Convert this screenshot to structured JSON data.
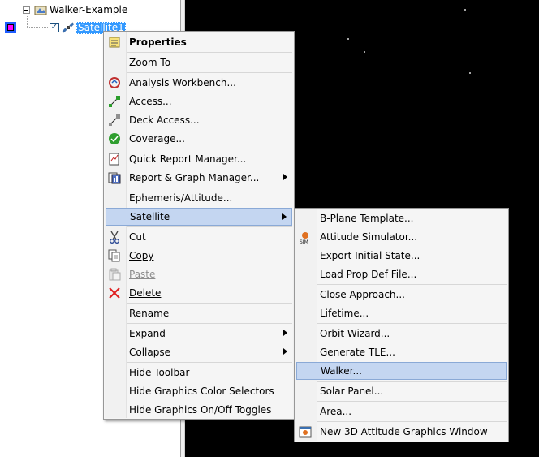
{
  "tree": {
    "root_label": "Walker-Example",
    "child_label": "Satellite1",
    "child_checked": true,
    "color_swatch": "#ff00ff"
  },
  "context_menu": {
    "items": [
      {
        "label": "Properties",
        "icon": "properties-icon",
        "bold": true
      },
      {
        "label": "Zoom To"
      },
      {
        "label": "Analysis Workbench...",
        "icon": "analysis-workbench-icon"
      },
      {
        "label": "Access...",
        "icon": "access-icon"
      },
      {
        "label": "Deck Access...",
        "icon": "deck-access-icon"
      },
      {
        "label": "Coverage...",
        "icon": "coverage-icon"
      },
      {
        "label": "Quick Report Manager...",
        "icon": "quick-report-icon"
      },
      {
        "label": "Report & Graph Manager...",
        "icon": "report-graph-icon",
        "submenu": true
      },
      {
        "label": "Ephemeris/Attitude..."
      },
      {
        "label": "Satellite",
        "submenu": true,
        "highlighted": true
      },
      {
        "label": "Cut",
        "icon": "scissors-icon"
      },
      {
        "label": "Copy",
        "icon": "copy-icon"
      },
      {
        "label": "Paste",
        "icon": "paste-icon",
        "disabled": true
      },
      {
        "label": "Delete",
        "icon": "delete-x-icon"
      },
      {
        "label": "Rename"
      },
      {
        "label": "Expand",
        "submenu": true
      },
      {
        "label": "Collapse",
        "submenu": true
      },
      {
        "label": "Hide Toolbar"
      },
      {
        "label": "Hide Graphics Color Selectors"
      },
      {
        "label": "Hide Graphics On/Off Toggles"
      }
    ]
  },
  "submenu": {
    "items": [
      {
        "label": "B-Plane Template..."
      },
      {
        "label": "Attitude Simulator...",
        "icon": "attitude-sim-icon"
      },
      {
        "label": "Export Initial State..."
      },
      {
        "label": "Load Prop Def File..."
      },
      {
        "label": "Close Approach..."
      },
      {
        "label": "Lifetime..."
      },
      {
        "label": "Orbit Wizard..."
      },
      {
        "label": "Generate TLE..."
      },
      {
        "label": "Walker...",
        "highlighted": true
      },
      {
        "label": "Solar Panel..."
      },
      {
        "label": "Area..."
      },
      {
        "label": "New 3D Attitude Graphics Window",
        "icon": "attitude-graphics-icon"
      }
    ]
  },
  "colors": {
    "highlight": "#c4d6f1",
    "selection": "#3399ff",
    "background_3d": "#000000"
  }
}
